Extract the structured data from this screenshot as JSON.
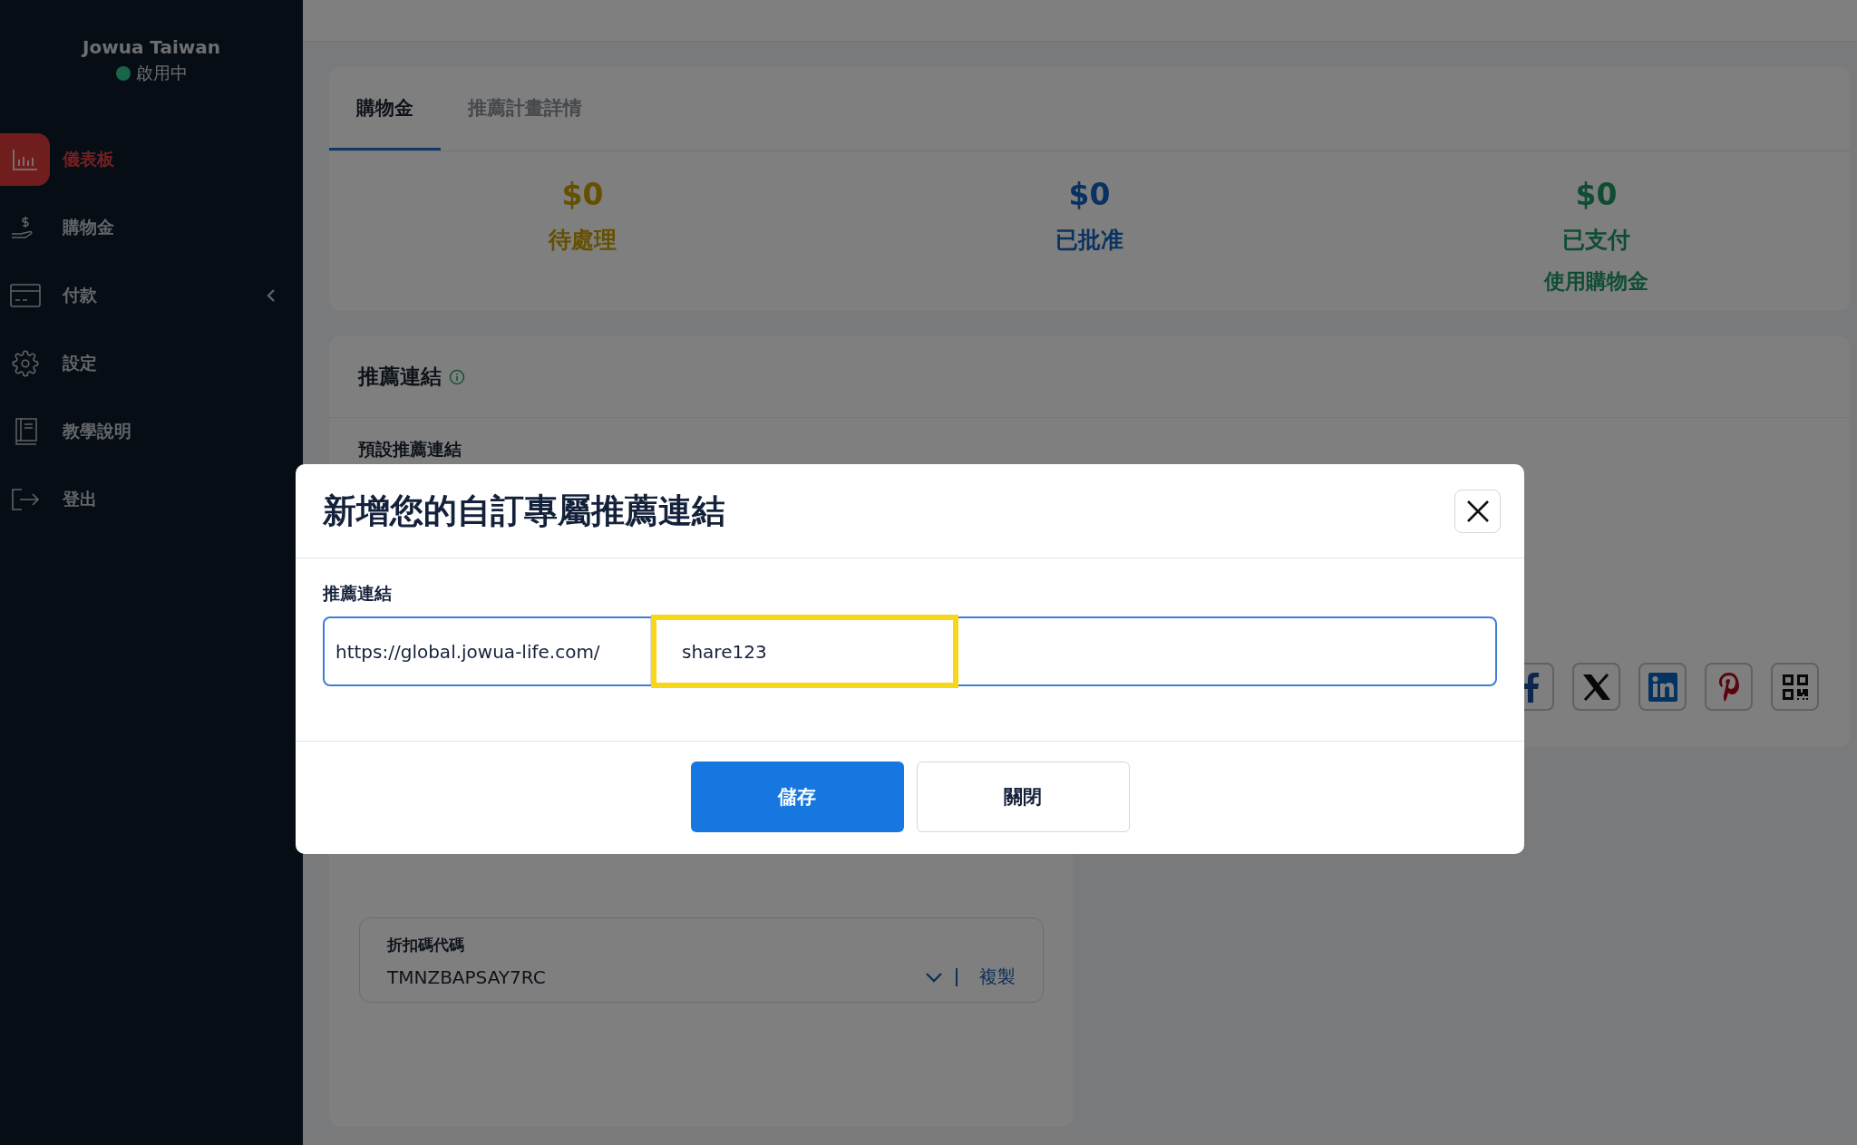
{
  "sidebar": {
    "account": {
      "name": "Jowua Taiwan",
      "status": "啟用中",
      "active": true
    },
    "items": [
      {
        "label": "儀表板",
        "selected": true,
        "expandable": false
      },
      {
        "label": "購物金",
        "selected": false,
        "expandable": false
      },
      {
        "label": "付款",
        "selected": false,
        "expandable": true
      },
      {
        "label": "設定",
        "selected": false,
        "expandable": false
      },
      {
        "label": "教學說明",
        "selected": false,
        "expandable": false
      },
      {
        "label": "登出",
        "selected": false,
        "expandable": false
      }
    ]
  },
  "tabs": [
    {
      "label": "購物金",
      "selected": true
    },
    {
      "label": "推薦計畫詳情",
      "selected": false
    }
  ],
  "stats": [
    {
      "amount": "$0",
      "label": "待處理",
      "kind": "pending"
    },
    {
      "amount": "$0",
      "label": "已批准",
      "kind": "approved"
    },
    {
      "amount": "$0",
      "label": "已支付",
      "sublabel": "使用購物金",
      "kind": "paid"
    }
  ],
  "referral": {
    "title": "推薦連結",
    "default_link_label": "預設推薦連結",
    "share_buttons": [
      {
        "kind": "facebook"
      },
      {
        "kind": "x"
      },
      {
        "kind": "linkedin"
      },
      {
        "kind": "pinterest"
      },
      {
        "kind": "qr"
      }
    ]
  },
  "discount": {
    "label": "折扣碼代碼",
    "value": "TMNZBAPSAY7RC",
    "copy": "複製"
  },
  "modal": {
    "title": "新增您的自訂專屬推薦連結",
    "field_label": "推薦連結",
    "prefix": "https://global.jowua-life.com/",
    "value": "share123",
    "highlighted": true,
    "buttons": [
      {
        "label": "儲存",
        "kind": "primary"
      },
      {
        "label": "關閉",
        "kind": "secondary"
      }
    ]
  }
}
